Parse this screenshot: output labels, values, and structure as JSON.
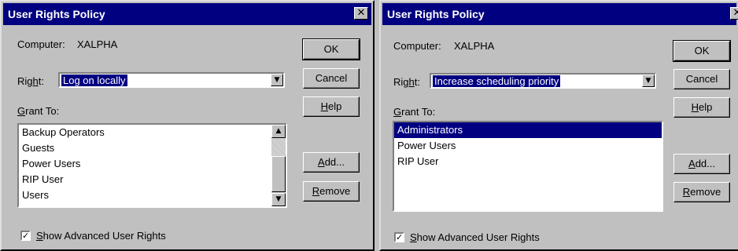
{
  "dialogs": [
    {
      "title": "User Rights Policy",
      "close_glyph": "✕",
      "computer_label": "Computer:",
      "computer_value": "XALPHA",
      "right_label": {
        "pre": "Rig",
        "u": "h",
        "post": "t:"
      },
      "right_value": "Log on locally",
      "grant_to_label": {
        "u": "G",
        "post": "rant To:"
      },
      "grant_list": [
        {
          "label": "Backup Operators",
          "selected": false
        },
        {
          "label": "Guests",
          "selected": false
        },
        {
          "label": "Power Users",
          "selected": false
        },
        {
          "label": "RIP User",
          "selected": false
        },
        {
          "label": "Users",
          "selected": false
        }
      ],
      "buttons": {
        "ok": "OK",
        "cancel": "Cancel",
        "help": {
          "u": "H",
          "post": "elp"
        },
        "add": {
          "u": "A",
          "post": "dd..."
        },
        "remove": {
          "u": "R",
          "post": "emove"
        }
      },
      "show_advanced": {
        "u": "S",
        "post": "how Advanced User Rights",
        "checked": true
      }
    },
    {
      "title": "User Rights Policy",
      "close_glyph": "✕",
      "computer_label": "Computer:",
      "computer_value": "XALPHA",
      "right_label": {
        "pre": "Rig",
        "u": "h",
        "post": "t:"
      },
      "right_value": "Increase scheduling priority",
      "grant_to_label": {
        "u": "G",
        "post": "rant To:"
      },
      "grant_list": [
        {
          "label": "Administrators",
          "selected": true
        },
        {
          "label": "Power Users",
          "selected": false
        },
        {
          "label": "RIP User",
          "selected": false
        }
      ],
      "buttons": {
        "ok": "OK",
        "cancel": "Cancel",
        "help": {
          "u": "H",
          "post": "elp"
        },
        "add": {
          "u": "A",
          "post": "dd..."
        },
        "remove": {
          "u": "R",
          "post": "emove"
        }
      },
      "show_advanced": {
        "u": "S",
        "post": "how Advanced User Rights",
        "checked": true
      }
    }
  ],
  "glyphs": {
    "arrow_down": "▼",
    "arrow_up": "▲",
    "check": "✓"
  },
  "colors": {
    "face": "#c0c0c0",
    "titlebar": "#000080",
    "selection": "#000080"
  }
}
